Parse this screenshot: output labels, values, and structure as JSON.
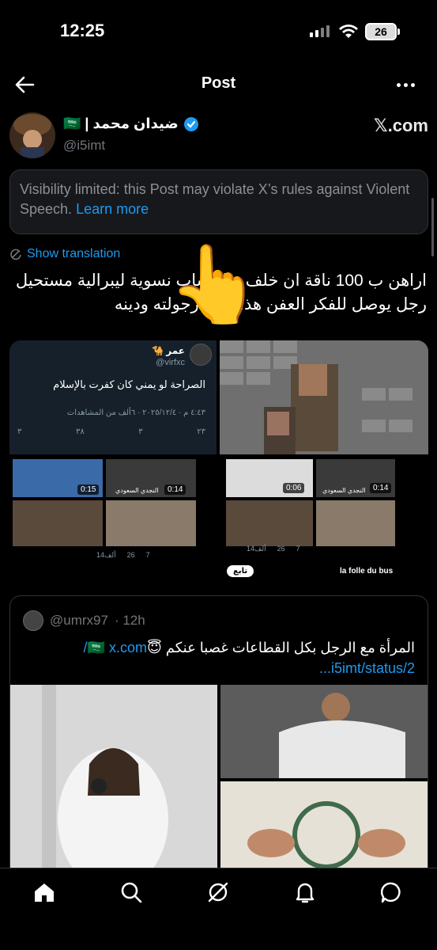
{
  "status_bar": {
    "time": "12:25",
    "battery": "26"
  },
  "topnav": {
    "title": "Post"
  },
  "author": {
    "name": "ضيدان محمد | 🇸🇦",
    "handle": "@i5imt",
    "watermark": "𝕏.com"
  },
  "visibility_notice": {
    "text": "Visibility limited: this Post may violate X’s rules against Violent Speech.",
    "link": "Learn more"
  },
  "post": {
    "show_translation": "Show translation",
    "text": "اراهن ب 100 ناقة ان خلف هالحساب نسوية ليبرالية مستحيل رجل يوصل للفكر العفن هذا ويبيع رجولته ودينه",
    "hand_emoji": "👆"
  },
  "media": {
    "quote_card": {
      "name": "عمر 🐪",
      "handle": "@virfxc",
      "text": "الصراحة لو يمني كان كفرت بالإسلام",
      "meta": "٤:٤٣ م · ٢٠٢٥/١٢/٤ · ٦ألف من المشاهدات",
      "actions": [
        "٢٣",
        "٣",
        "٣٨",
        "٣"
      ]
    },
    "videos": [
      {
        "time": "0:15"
      },
      {
        "time": "0:14"
      },
      {
        "time": "0:06"
      },
      {
        "time": "0:14"
      }
    ],
    "video_captions": [
      "النجدي السعودي",
      "النجدي السعودي"
    ],
    "small_actions_left": [
      "7",
      "26",
      "14ألف"
    ],
    "small_actions_right": [
      "7",
      "26",
      "14ألف"
    ],
    "follow_chip": "تابع",
    "folle_text": "la folle du bus"
  },
  "quoted_post": {
    "handle": "@umrx97",
    "time": "· 12h",
    "text": "المرأة مع الرجل بكل القطاعات غصبا عنكم 😇🇸🇦",
    "link_line1": "x.com/",
    "link_line2": "i5imt/status/2..."
  },
  "tabbar": [
    "home-icon",
    "search-icon",
    "grok-icon",
    "notifications-icon",
    "messages-icon"
  ]
}
